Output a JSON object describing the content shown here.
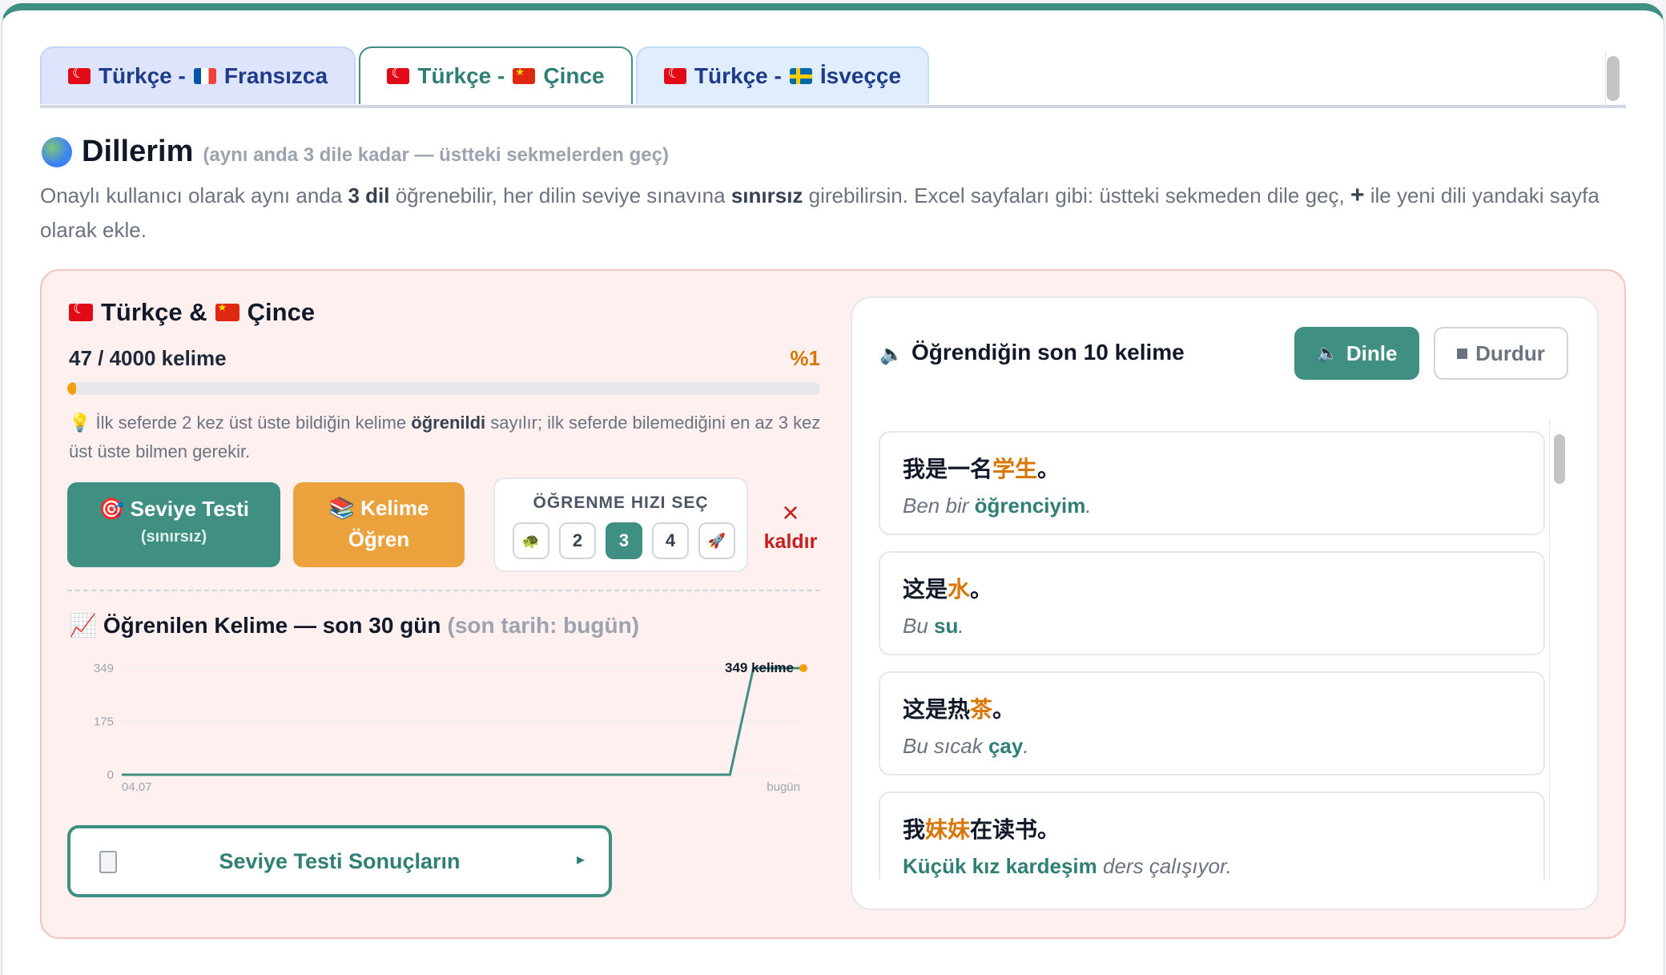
{
  "tabs": [
    {
      "label_a": "Türkçe -",
      "label_b": "Fransızca"
    },
    {
      "label_a": "Türkçe -",
      "label_b": "Çince"
    },
    {
      "label_a": "Türkçe -",
      "label_b": "İsveççe"
    }
  ],
  "section": {
    "title": "Dillerim",
    "note": "(aynı anda 3 dile kadar — üstteki sekmelerden geç)",
    "desc_1": "Onaylı kullanıcı olarak aynı anda ",
    "desc_b1": "3 dil",
    "desc_2": " öğrenebilir, her dilin seviye sınavına ",
    "desc_b2": "sınırsız",
    "desc_3": " girebilirsin. Excel sayfaları gibi: üstteki sekmeden dile geç, ",
    "desc_plus": "+",
    "desc_4": " ile yeni dili yandaki sayfa olarak ekle."
  },
  "language": {
    "title_a": "Türkçe &",
    "title_b": "Çince",
    "count": "47 / 4000 kelime",
    "percent": "%1",
    "progress_fraction": 0.01175,
    "hint_1": "İlk seferde 2 kez üst üste bildiğin kelime ",
    "hint_b": "öğrenildi",
    "hint_2": " sayılır; ilk seferde bilemediğini en az 3 kez üst üste bilmen gerekir."
  },
  "buttons": {
    "level_test": "Seviye Testi",
    "level_test_sub": "(sınırsız)",
    "learn_line1": "Kelime",
    "learn_line2": "Öğren",
    "remove_icon": "×",
    "remove": "kaldır",
    "results": "Seviye Testi Sonuçların",
    "results_arrow": "▸"
  },
  "speed": {
    "label": "ÖĞRENME HIZI SEÇ",
    "options": [
      "🐢",
      "2",
      "3",
      "4",
      "🚀"
    ],
    "selected": "3"
  },
  "chart": {
    "title": "Öğrenilen Kelime — son 30 gün",
    "title_muted": "(son tarih: bugün)"
  },
  "chart_data": {
    "type": "line",
    "x_labels": [
      "04.07",
      "bugün"
    ],
    "y_ticks": [
      0,
      175,
      349
    ],
    "ylim": [
      0,
      349
    ],
    "values": [
      0,
      0,
      0,
      0,
      0,
      0,
      0,
      0,
      0,
      0,
      0,
      0,
      0,
      0,
      0,
      0,
      0,
      0,
      0,
      0,
      0,
      0,
      0,
      0,
      0,
      0,
      0,
      349,
      349,
      349
    ],
    "last_label": "349 kelime",
    "colors": {
      "line": "#3f8f82",
      "marker": "#f59e0b"
    }
  },
  "panel": {
    "title": "Öğrendiğin son 10 kelime",
    "listen": "Dinle",
    "stop": "Durdur",
    "words": [
      {
        "zh_pre": "我是一名",
        "zh_hl": "学生",
        "zh_post": "。",
        "tr_pre": "Ben bir ",
        "tr_hl": "öğrenciyim",
        "tr_post": "."
      },
      {
        "zh_pre": "这是",
        "zh_hl": "水",
        "zh_post": "。",
        "tr_pre": "Bu ",
        "tr_hl": "su",
        "tr_post": "."
      },
      {
        "zh_pre": "这是热",
        "zh_hl": "茶",
        "zh_post": "。",
        "tr_pre": "Bu sıcak ",
        "tr_hl": "çay",
        "tr_post": "."
      },
      {
        "zh_pre": "我",
        "zh_hl": "妹妹",
        "zh_post": "在读书。",
        "tr_pre": "",
        "tr_hl": "Küçük kız kardeşim",
        "tr_post": " ders çalışıyor."
      }
    ]
  }
}
